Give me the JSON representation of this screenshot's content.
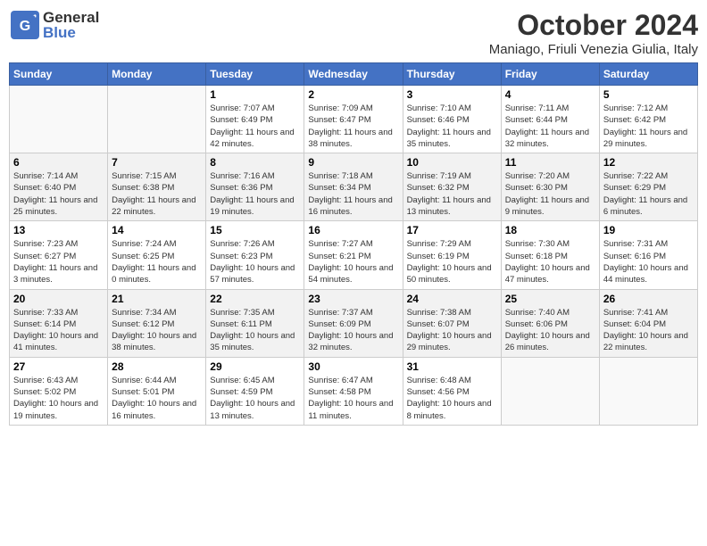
{
  "header": {
    "logo_general": "General",
    "logo_blue": "Blue",
    "month": "October 2024",
    "location": "Maniago, Friuli Venezia Giulia, Italy"
  },
  "days_of_week": [
    "Sunday",
    "Monday",
    "Tuesday",
    "Wednesday",
    "Thursday",
    "Friday",
    "Saturday"
  ],
  "weeks": [
    [
      {
        "day": "",
        "info": ""
      },
      {
        "day": "",
        "info": ""
      },
      {
        "day": "1",
        "info": "Sunrise: 7:07 AM\nSunset: 6:49 PM\nDaylight: 11 hours and 42 minutes."
      },
      {
        "day": "2",
        "info": "Sunrise: 7:09 AM\nSunset: 6:47 PM\nDaylight: 11 hours and 38 minutes."
      },
      {
        "day": "3",
        "info": "Sunrise: 7:10 AM\nSunset: 6:46 PM\nDaylight: 11 hours and 35 minutes."
      },
      {
        "day": "4",
        "info": "Sunrise: 7:11 AM\nSunset: 6:44 PM\nDaylight: 11 hours and 32 minutes."
      },
      {
        "day": "5",
        "info": "Sunrise: 7:12 AM\nSunset: 6:42 PM\nDaylight: 11 hours and 29 minutes."
      }
    ],
    [
      {
        "day": "6",
        "info": "Sunrise: 7:14 AM\nSunset: 6:40 PM\nDaylight: 11 hours and 25 minutes."
      },
      {
        "day": "7",
        "info": "Sunrise: 7:15 AM\nSunset: 6:38 PM\nDaylight: 11 hours and 22 minutes."
      },
      {
        "day": "8",
        "info": "Sunrise: 7:16 AM\nSunset: 6:36 PM\nDaylight: 11 hours and 19 minutes."
      },
      {
        "day": "9",
        "info": "Sunrise: 7:18 AM\nSunset: 6:34 PM\nDaylight: 11 hours and 16 minutes."
      },
      {
        "day": "10",
        "info": "Sunrise: 7:19 AM\nSunset: 6:32 PM\nDaylight: 11 hours and 13 minutes."
      },
      {
        "day": "11",
        "info": "Sunrise: 7:20 AM\nSunset: 6:30 PM\nDaylight: 11 hours and 9 minutes."
      },
      {
        "day": "12",
        "info": "Sunrise: 7:22 AM\nSunset: 6:29 PM\nDaylight: 11 hours and 6 minutes."
      }
    ],
    [
      {
        "day": "13",
        "info": "Sunrise: 7:23 AM\nSunset: 6:27 PM\nDaylight: 11 hours and 3 minutes."
      },
      {
        "day": "14",
        "info": "Sunrise: 7:24 AM\nSunset: 6:25 PM\nDaylight: 11 hours and 0 minutes."
      },
      {
        "day": "15",
        "info": "Sunrise: 7:26 AM\nSunset: 6:23 PM\nDaylight: 10 hours and 57 minutes."
      },
      {
        "day": "16",
        "info": "Sunrise: 7:27 AM\nSunset: 6:21 PM\nDaylight: 10 hours and 54 minutes."
      },
      {
        "day": "17",
        "info": "Sunrise: 7:29 AM\nSunset: 6:19 PM\nDaylight: 10 hours and 50 minutes."
      },
      {
        "day": "18",
        "info": "Sunrise: 7:30 AM\nSunset: 6:18 PM\nDaylight: 10 hours and 47 minutes."
      },
      {
        "day": "19",
        "info": "Sunrise: 7:31 AM\nSunset: 6:16 PM\nDaylight: 10 hours and 44 minutes."
      }
    ],
    [
      {
        "day": "20",
        "info": "Sunrise: 7:33 AM\nSunset: 6:14 PM\nDaylight: 10 hours and 41 minutes."
      },
      {
        "day": "21",
        "info": "Sunrise: 7:34 AM\nSunset: 6:12 PM\nDaylight: 10 hours and 38 minutes."
      },
      {
        "day": "22",
        "info": "Sunrise: 7:35 AM\nSunset: 6:11 PM\nDaylight: 10 hours and 35 minutes."
      },
      {
        "day": "23",
        "info": "Sunrise: 7:37 AM\nSunset: 6:09 PM\nDaylight: 10 hours and 32 minutes."
      },
      {
        "day": "24",
        "info": "Sunrise: 7:38 AM\nSunset: 6:07 PM\nDaylight: 10 hours and 29 minutes."
      },
      {
        "day": "25",
        "info": "Sunrise: 7:40 AM\nSunset: 6:06 PM\nDaylight: 10 hours and 26 minutes."
      },
      {
        "day": "26",
        "info": "Sunrise: 7:41 AM\nSunset: 6:04 PM\nDaylight: 10 hours and 22 minutes."
      }
    ],
    [
      {
        "day": "27",
        "info": "Sunrise: 6:43 AM\nSunset: 5:02 PM\nDaylight: 10 hours and 19 minutes."
      },
      {
        "day": "28",
        "info": "Sunrise: 6:44 AM\nSunset: 5:01 PM\nDaylight: 10 hours and 16 minutes."
      },
      {
        "day": "29",
        "info": "Sunrise: 6:45 AM\nSunset: 4:59 PM\nDaylight: 10 hours and 13 minutes."
      },
      {
        "day": "30",
        "info": "Sunrise: 6:47 AM\nSunset: 4:58 PM\nDaylight: 10 hours and 11 minutes."
      },
      {
        "day": "31",
        "info": "Sunrise: 6:48 AM\nSunset: 4:56 PM\nDaylight: 10 hours and 8 minutes."
      },
      {
        "day": "",
        "info": ""
      },
      {
        "day": "",
        "info": ""
      }
    ]
  ]
}
